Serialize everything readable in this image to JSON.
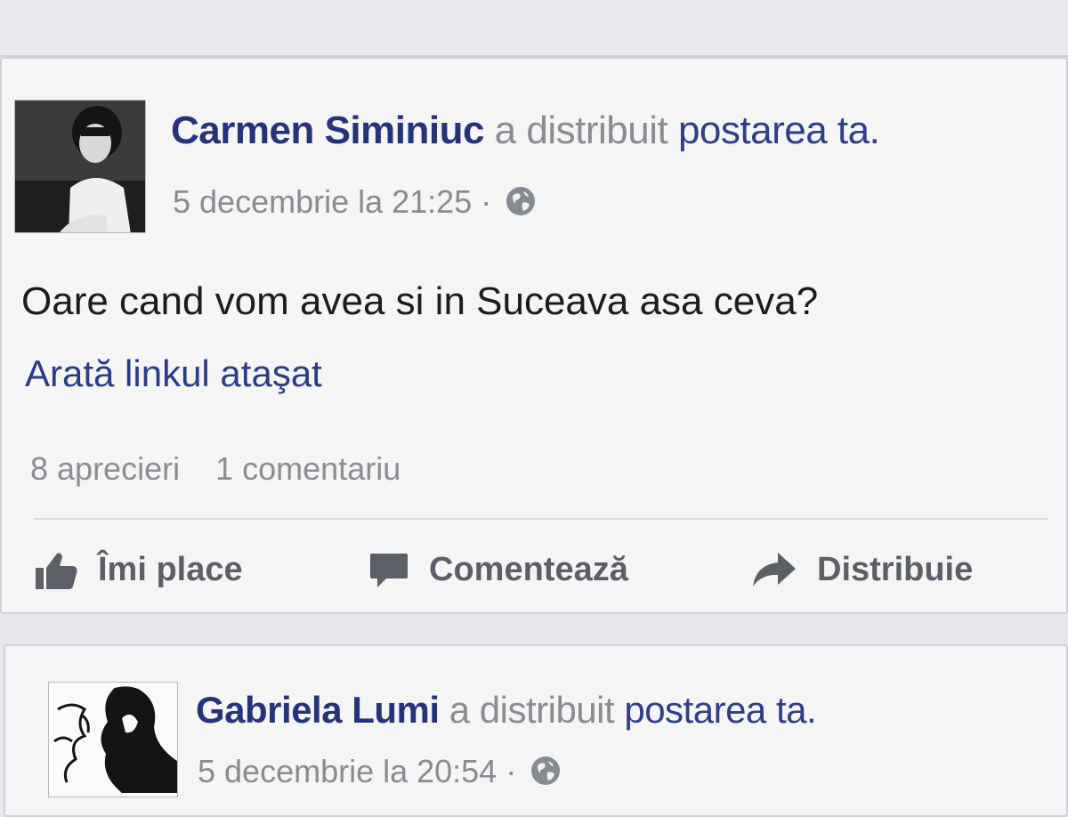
{
  "notifications": [
    {
      "actor": "Carmen Siminiuc",
      "action": "a distribuit",
      "object": "postarea",
      "suffix": "ta.",
      "timestamp": "5 decembrie la 21:25",
      "separator": "·",
      "privacy_icon": "globe-icon",
      "post_text": "Oare cand vom avea si in Suceava asa ceva?",
      "attached_link": "Arată linkul ataşat",
      "likes": "8 aprecieri",
      "comments": "1 comentariu",
      "actions": {
        "like": "Îmi place",
        "comment": "Comentează",
        "share": "Distribuie"
      }
    },
    {
      "actor": "Gabriela Lumi",
      "action": "a distribuit",
      "object": "postarea",
      "suffix": "ta.",
      "timestamp": "5 decembrie la 20:54",
      "separator": "·",
      "privacy_icon": "globe-icon"
    }
  ],
  "colors": {
    "name": "#26337a",
    "link": "#2b3b86",
    "meta": "#888b90",
    "action": "#5c5f66"
  }
}
